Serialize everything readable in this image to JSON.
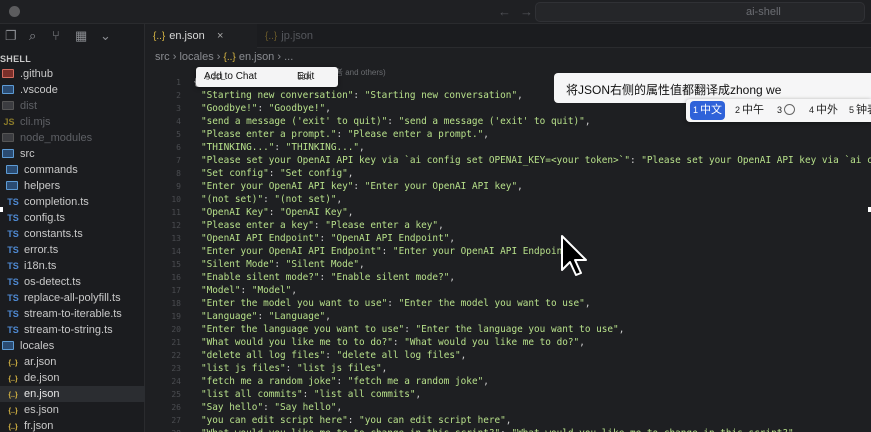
{
  "window": {
    "title": "ai-shell",
    "back_glyph": "←",
    "fwd_glyph": "→"
  },
  "sidebar": {
    "project": "SHELL",
    "icons": [
      "files-icon",
      "search-icon",
      "source-control-icon",
      "extensions-icon",
      "chevron-down-icon"
    ],
    "items": [
      {
        "label": ".github",
        "kind": "folder",
        "color": "red",
        "indent": 0,
        "dim": false
      },
      {
        "label": ".vscode",
        "kind": "folder",
        "color": "blue",
        "indent": 0,
        "dim": false
      },
      {
        "label": "dist",
        "kind": "folder",
        "color": "gray",
        "indent": 0,
        "dim": true
      },
      {
        "label": "cli.mjs",
        "kind": "js",
        "indent": 0,
        "dim": true
      },
      {
        "label": "node_modules",
        "kind": "folder",
        "color": "gray",
        "indent": 0,
        "dim": true
      },
      {
        "label": "src",
        "kind": "folder",
        "color": "blue",
        "indent": 0,
        "dim": false
      },
      {
        "label": "commands",
        "kind": "folder",
        "color": "blue",
        "indent": 1,
        "dim": false
      },
      {
        "label": "helpers",
        "kind": "folder",
        "color": "blue",
        "indent": 1,
        "dim": false
      },
      {
        "label": "completion.ts",
        "kind": "ts",
        "indent": 1,
        "dim": false
      },
      {
        "label": "config.ts",
        "kind": "ts",
        "indent": 1,
        "dim": false
      },
      {
        "label": "constants.ts",
        "kind": "ts",
        "indent": 1,
        "dim": false
      },
      {
        "label": "error.ts",
        "kind": "ts",
        "indent": 1,
        "dim": false
      },
      {
        "label": "i18n.ts",
        "kind": "ts",
        "indent": 1,
        "dim": false
      },
      {
        "label": "os-detect.ts",
        "kind": "ts",
        "indent": 1,
        "dim": false
      },
      {
        "label": "replace-all-polyfill.ts",
        "kind": "ts",
        "indent": 1,
        "dim": false
      },
      {
        "label": "stream-to-iterable.ts",
        "kind": "ts",
        "indent": 1,
        "dim": false
      },
      {
        "label": "stream-to-string.ts",
        "kind": "ts",
        "indent": 1,
        "dim": false
      },
      {
        "label": "locales",
        "kind": "folder",
        "color": "blue",
        "indent": 0,
        "dim": false
      },
      {
        "label": "ar.json",
        "kind": "json",
        "indent": 1,
        "dim": false
      },
      {
        "label": "de.json",
        "kind": "json",
        "indent": 1,
        "dim": false
      },
      {
        "label": "en.json",
        "kind": "json",
        "indent": 1,
        "dim": false,
        "active": true
      },
      {
        "label": "es.json",
        "kind": "json",
        "indent": 1,
        "dim": false
      },
      {
        "label": "fr.json",
        "kind": "json",
        "indent": 1,
        "dim": false
      }
    ]
  },
  "tabs": [
    {
      "label": "en.json",
      "active": true,
      "close": "×"
    },
    {
      "label": "jp.json",
      "active": false
    }
  ],
  "breadcrumb": {
    "parts": [
      "src",
      "locales"
    ],
    "file": "en.json",
    "tail": "..."
  },
  "popup": {
    "add_to_chat": "Add to Chat",
    "add_shortcut": "⇧⌘L",
    "edit": "Edit",
    "edit_shortcut": "⌘K",
    "behind": "者 and others)"
  },
  "ime": {
    "input": "将JSON右侧的属性值都翻译成zhong we",
    "candidates": [
      {
        "n": "1",
        "text": "中文",
        "selected": true
      },
      {
        "n": "2",
        "text": "中午",
        "selected": false
      },
      {
        "n": "3",
        "text": "",
        "clock": true,
        "selected": false
      },
      {
        "n": "4",
        "text": "中外",
        "selected": false
      },
      {
        "n": "5",
        "text": "钟表",
        "selected": false
      }
    ]
  },
  "editor": {
    "line_numbers": [
      "1",
      "2",
      "3",
      "4",
      "5",
      "6",
      "7",
      "8",
      "9",
      "10",
      "11",
      "12",
      "13",
      "14",
      "15",
      "16",
      "17",
      "18",
      "19",
      "20",
      "21",
      "22",
      "23",
      "24",
      "25",
      "26",
      "27",
      "28"
    ],
    "header_text": "5",
    "open_brace": "{",
    "lines": [
      [
        "\"Starting new conversation\"",
        "\"Starting new conversation\""
      ],
      [
        "\"Goodbye!\"",
        "\"Goodbye!\""
      ],
      [
        "\"send a message ('exit' to quit)\"",
        "\"send a message ('exit' to quit)\""
      ],
      [
        "\"Please enter a prompt.\"",
        "\"Please enter a prompt.\""
      ],
      [
        "\"THINKING...\"",
        "\"THINKING...\""
      ],
      [
        "\"Please set your OpenAI API key via `ai config set OPENAI_KEY=<your token>`\"",
        "\"Please set your OpenAI API key via `ai config set O"
      ],
      [
        "\"Set config\"",
        "\"Set config\""
      ],
      [
        "\"Enter your OpenAI API key\"",
        "\"Enter your OpenAI API key\""
      ],
      [
        "\"(not set)\"",
        "\"(not set)\""
      ],
      [
        "\"OpenAI Key\"",
        "\"OpenAI Key\""
      ],
      [
        "\"Please enter a key\"",
        "\"Please enter a key\""
      ],
      [
        "\"OpenAI API Endpoint\"",
        "\"OpenAI API Endpoint\""
      ],
      [
        "\"Enter your OpenAI API Endpoint\"",
        "\"Enter your OpenAI API Endpoint\""
      ],
      [
        "\"Silent Mode\"",
        "\"Silent Mode\""
      ],
      [
        "\"Enable silent mode?\"",
        "\"Enable silent mode?\""
      ],
      [
        "\"Model\"",
        "\"Model\""
      ],
      [
        "\"Enter the model you want to use\"",
        "\"Enter the model you want to use\""
      ],
      [
        "\"Language\"",
        "\"Language\""
      ],
      [
        "\"Enter the language you want to use\"",
        "\"Enter the language you want to use\""
      ],
      [
        "\"What would you like me to to do?\"",
        "\"What would you like me to do?\""
      ],
      [
        "\"delete all log files\"",
        "\"delete all log files\""
      ],
      [
        "\"list js files\"",
        "\"list js files\""
      ],
      [
        "\"fetch me a random joke\"",
        "\"fetch me a random joke\""
      ],
      [
        "\"list all commits\"",
        "\"list all commits\""
      ],
      [
        "\"Say hello\"",
        "\"Say hello\""
      ],
      [
        "\"you can edit script here\"",
        "\"you can edit script here\""
      ],
      [
        "\"What would you like me to to change in this script?\"",
        "\"What would you like me to change in this script?\""
      ]
    ]
  }
}
